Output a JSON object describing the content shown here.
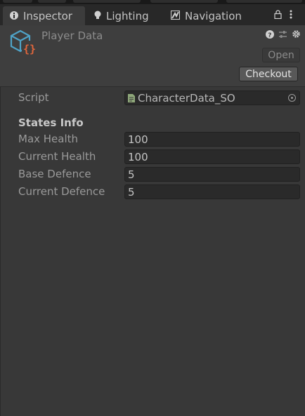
{
  "tabs": [
    {
      "label": "Inspector",
      "icon": "info-icon",
      "active": true
    },
    {
      "label": "Lighting",
      "icon": "lightbulb-icon",
      "active": false
    },
    {
      "label": "Navigation",
      "icon": "navigation-icon",
      "active": false
    }
  ],
  "tab_actions": {
    "lock_icon": "lock-icon",
    "menu_icon": "kebab-menu-icon"
  },
  "asset": {
    "title": "Player Data",
    "icon": "scriptable-object-icon",
    "header_icons": [
      "help-icon",
      "preset-sliders-icon",
      "settings-gear-icon"
    ],
    "open_label": "Open",
    "checkout_label": "Checkout"
  },
  "script_field": {
    "label": "Script",
    "value": "CharacterData_SO"
  },
  "section": {
    "title": "States Info"
  },
  "fields": [
    {
      "label": "Max Health",
      "value": "100"
    },
    {
      "label": "Current Health",
      "value": "100"
    },
    {
      "label": "Base Defence",
      "value": "5"
    },
    {
      "label": "Current Defence",
      "value": "5"
    }
  ],
  "colors": {
    "accent_icon": "#4fa3c7",
    "accent_braces": "#e0663c",
    "panel_bg": "#383838",
    "field_bg": "#2a2a2a"
  }
}
